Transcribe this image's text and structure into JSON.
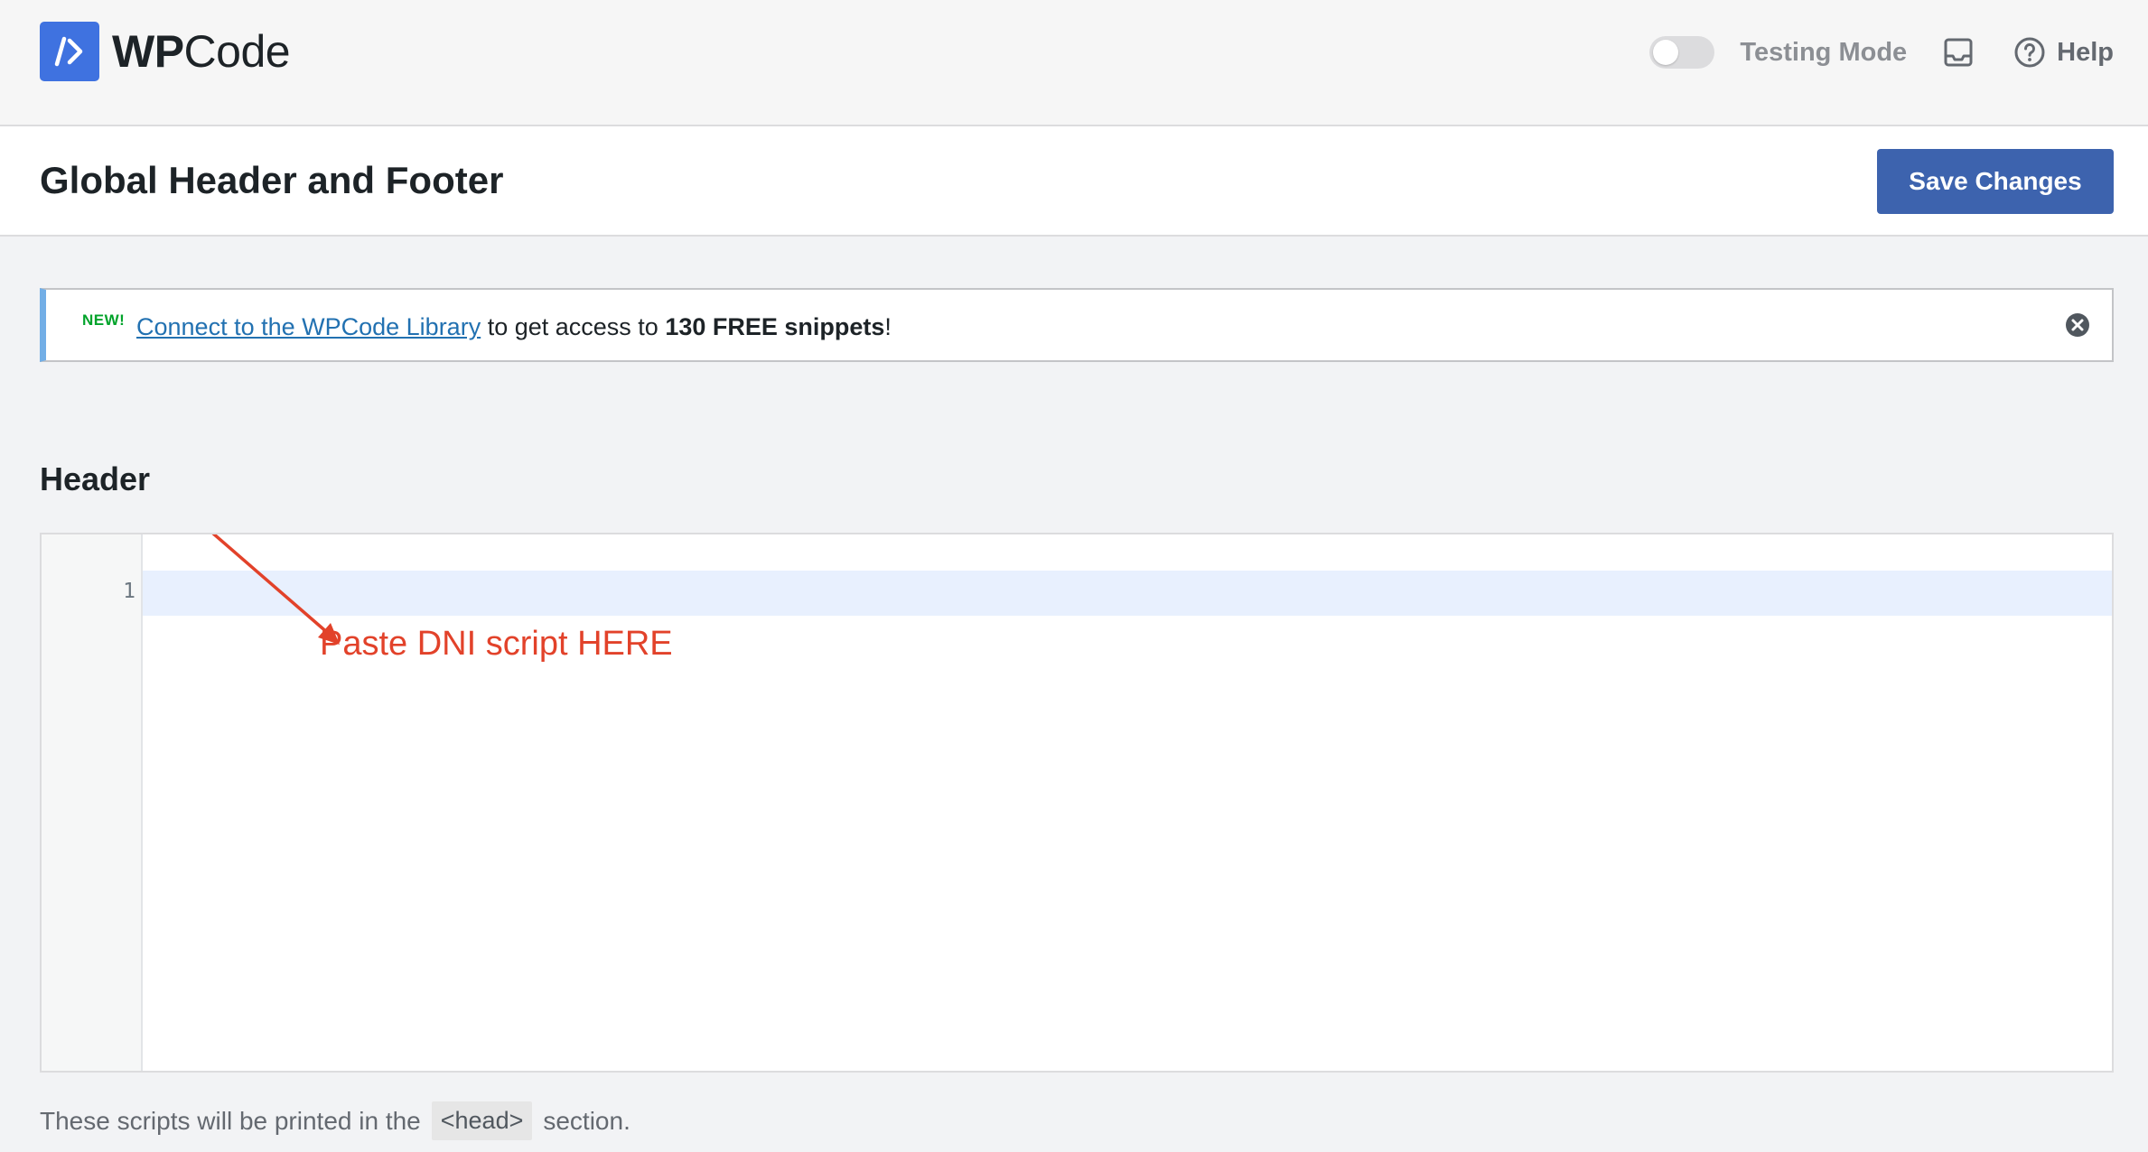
{
  "topbar": {
    "logo_bold": "WP",
    "logo_regular": "Code",
    "testing_mode_label": "Testing Mode",
    "help_label": "Help"
  },
  "page": {
    "title": "Global Header and Footer",
    "save_label": "Save Changes"
  },
  "notice": {
    "badge": "NEW!",
    "link_text": "Connect to the WPCode Library",
    "middle_text": " to get access to ",
    "bold_text": "130 FREE snippets",
    "end_text": "!"
  },
  "header_section": {
    "title": "Header",
    "line_number": "1",
    "annotation": "Paste DNI script HERE",
    "helper_prefix": "These scripts will be printed in the",
    "helper_tag": "<head>",
    "helper_suffix": "section."
  },
  "colors": {
    "brand": "#3f72e0",
    "save_button": "#3d63ae",
    "notice_accent": "#72aee6",
    "new_badge": "#00a32a",
    "annotation": "#e2422a"
  },
  "icons": {
    "logo": "wpcode-logo-icon",
    "inbox": "inbox-icon",
    "help": "help-circle-icon",
    "close": "close-circle-icon"
  }
}
